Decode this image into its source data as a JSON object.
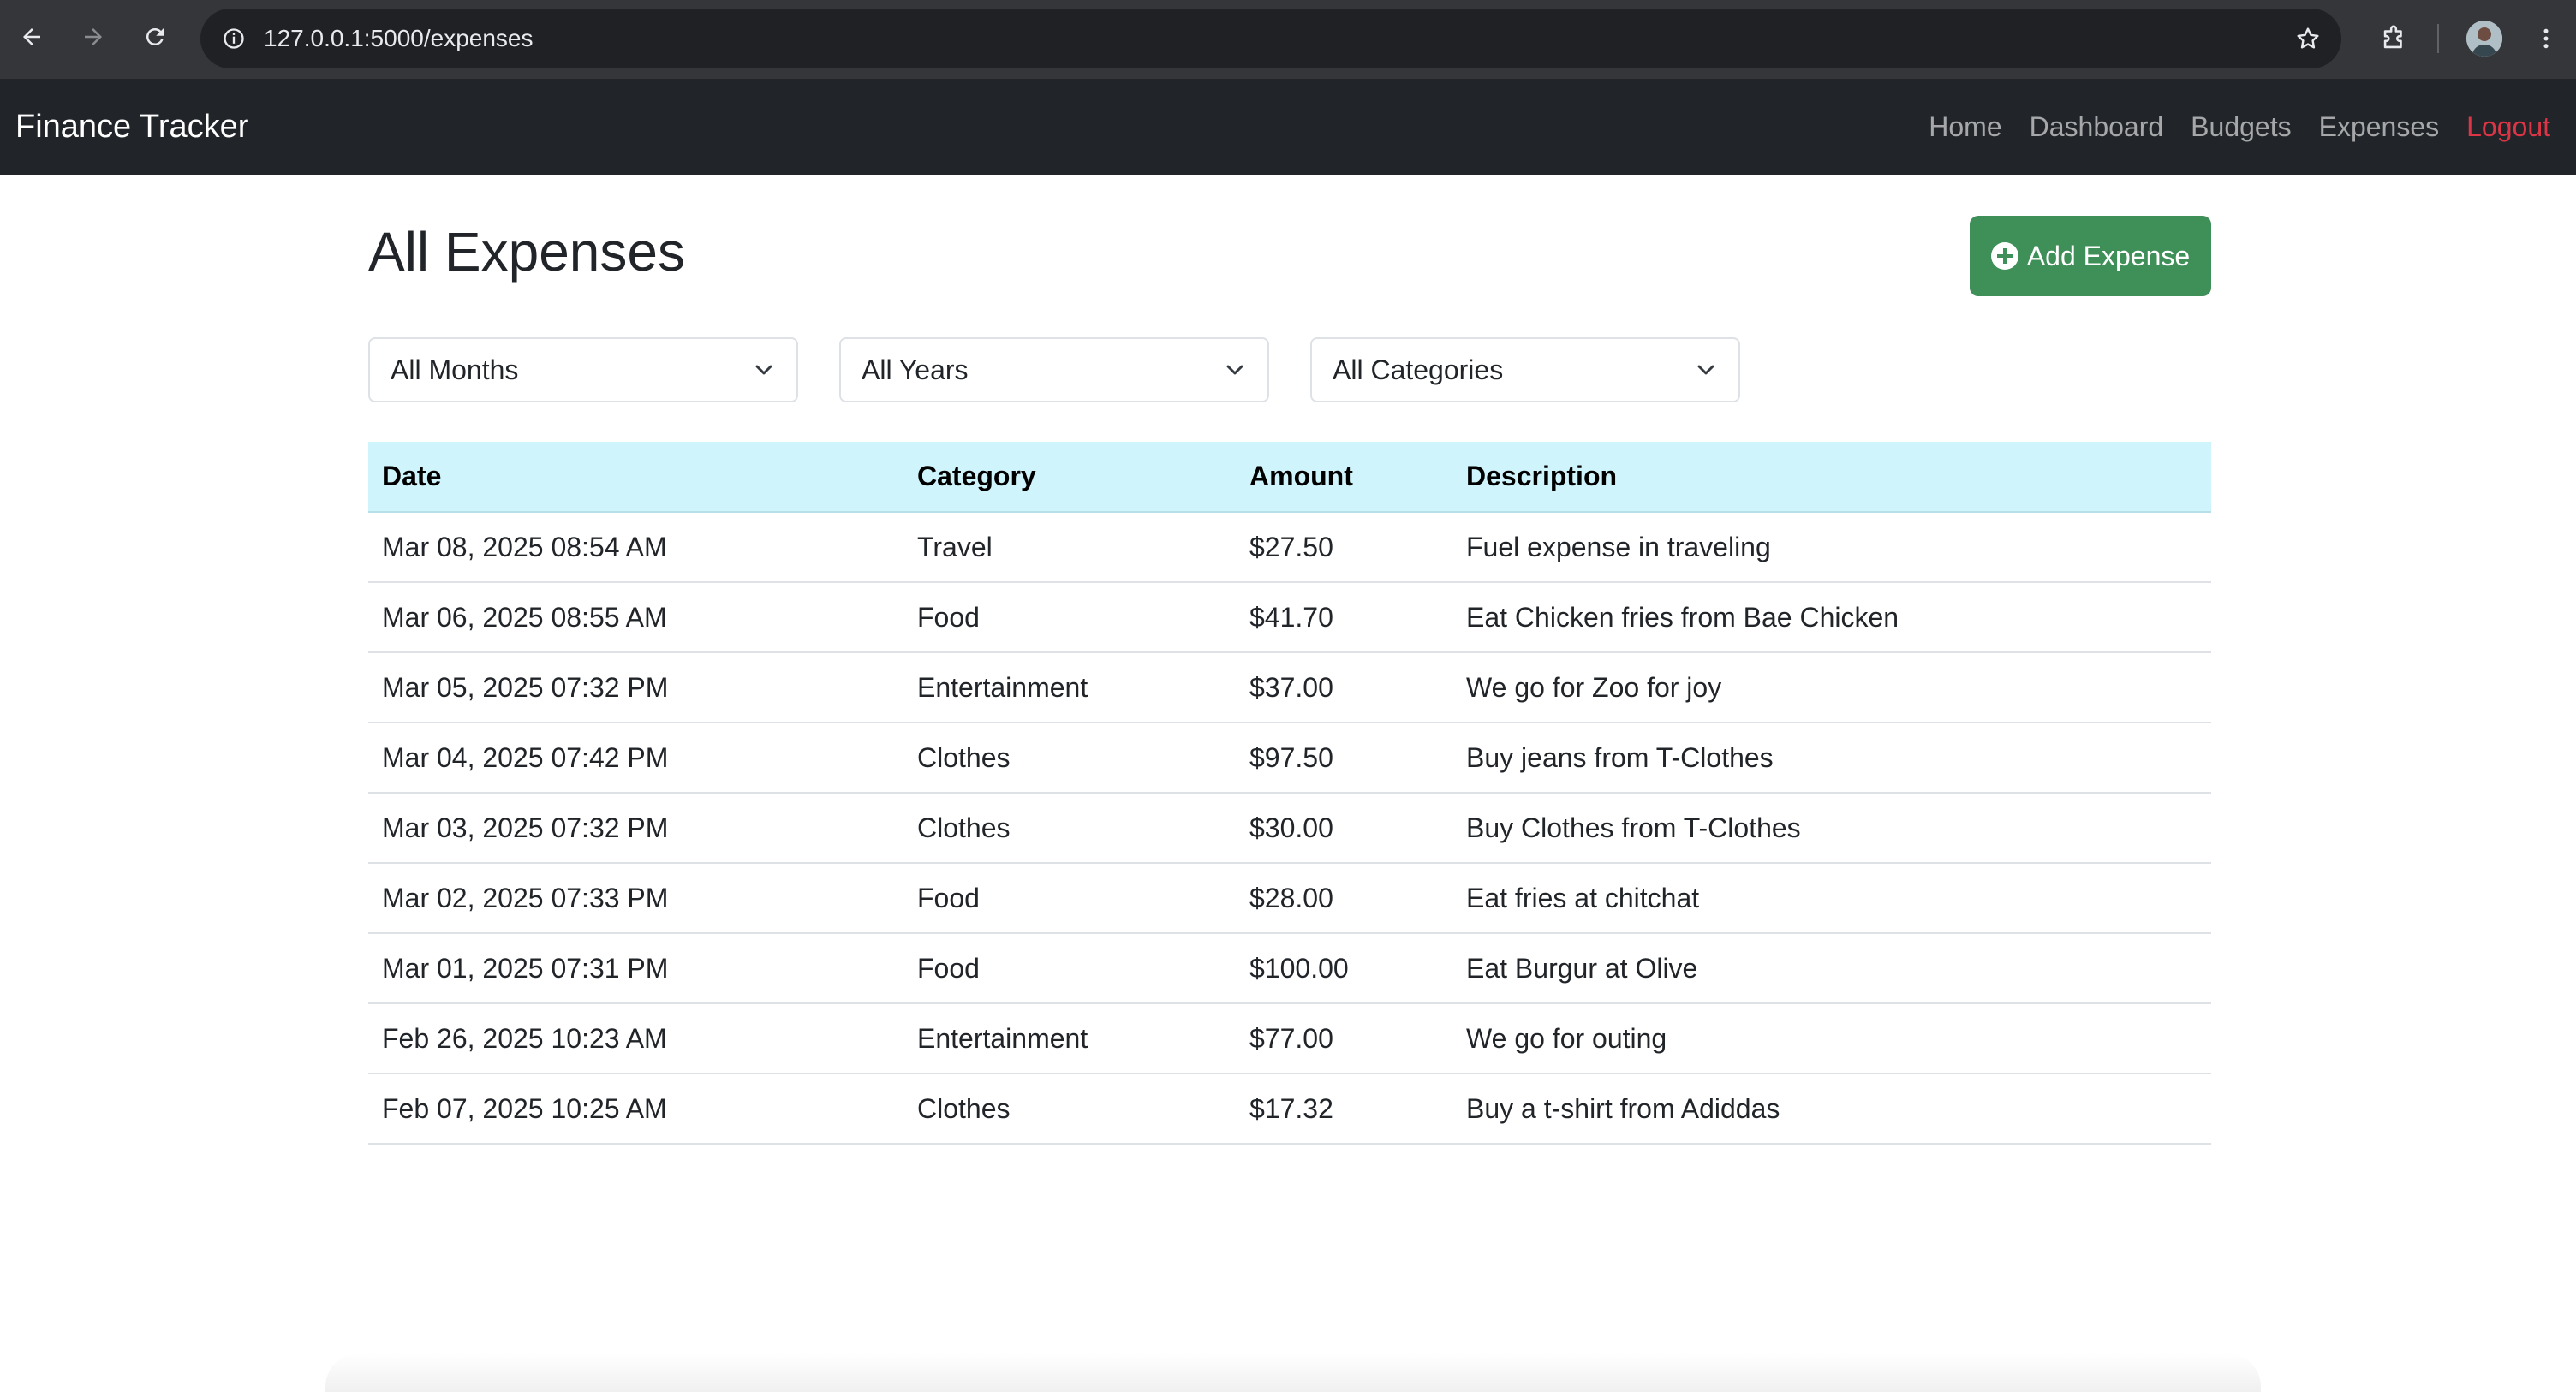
{
  "browser": {
    "url": "127.0.0.1:5000/expenses",
    "icons": [
      "back-icon",
      "forward-icon",
      "reload-icon",
      "site-info-icon",
      "bookmark-star-icon",
      "extensions-icon",
      "profile-avatar",
      "kebab-menu-icon"
    ]
  },
  "navbar": {
    "brand": "Finance Tracker",
    "links": [
      "Home",
      "Dashboard",
      "Budgets",
      "Expenses"
    ],
    "logout": "Logout",
    "logout_color": "#dc3545"
  },
  "page": {
    "title": "All Expenses",
    "add_button": "Add Expense",
    "add_button_color": "#3f8f59"
  },
  "filters": {
    "month": "All Months",
    "year": "All Years",
    "category": "All Categories"
  },
  "table": {
    "header_color": "#cff4fc",
    "columns": [
      "Date",
      "Category",
      "Amount",
      "Description"
    ],
    "rows": [
      [
        "Mar 08, 2025 08:54 AM",
        "Travel",
        "$27.50",
        "Fuel expense in traveling"
      ],
      [
        "Mar 06, 2025 08:55 AM",
        "Food",
        "$41.70",
        "Eat Chicken fries from Bae Chicken"
      ],
      [
        "Mar 05, 2025 07:32 PM",
        "Entertainment",
        "$37.00",
        "We go for Zoo for joy"
      ],
      [
        "Mar 04, 2025 07:42 PM",
        "Clothes",
        "$97.50",
        "Buy jeans from T-Clothes"
      ],
      [
        "Mar 03, 2025 07:32 PM",
        "Clothes",
        "$30.00",
        "Buy Clothes from T-Clothes"
      ],
      [
        "Mar 02, 2025 07:33 PM",
        "Food",
        "$28.00",
        "Eat fries at chitchat"
      ],
      [
        "Mar 01, 2025 07:31 PM",
        "Food",
        "$100.00",
        "Eat Burgur at Olive"
      ],
      [
        "Feb 26, 2025 10:23 AM",
        "Entertainment",
        "$77.00",
        "We go for outing"
      ],
      [
        "Feb 07, 2025 10:25 AM",
        "Clothes",
        "$17.32",
        "Buy a t-shirt from Adiddas"
      ]
    ]
  }
}
